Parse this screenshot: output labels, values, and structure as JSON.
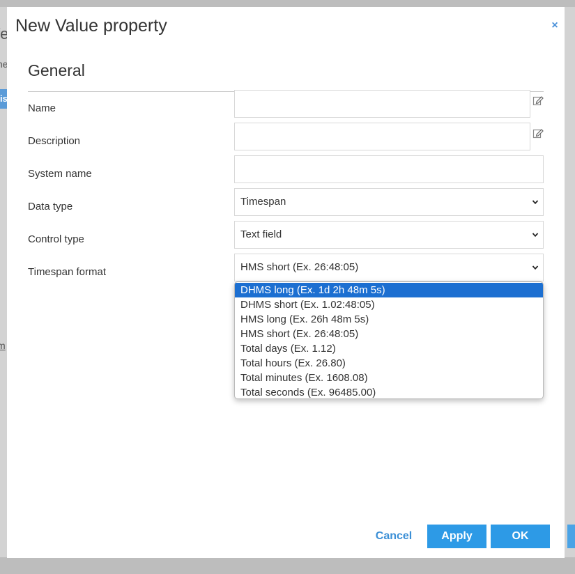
{
  "background": {
    "left_title_fragment": "fe",
    "left_text_fragment": "he",
    "left_button_fragment": "is",
    "left_link_fragment": "m"
  },
  "dialog": {
    "title": "New Value property",
    "close_glyph": "×",
    "section_title": "General"
  },
  "fields": {
    "name": {
      "label": "Name",
      "value": ""
    },
    "description": {
      "label": "Description",
      "value": ""
    },
    "system_name": {
      "label": "System name",
      "value": ""
    },
    "data_type": {
      "label": "Data type",
      "value": "Timespan"
    },
    "control_type": {
      "label": "Control type",
      "value": "Text field"
    },
    "timespan_format": {
      "label": "Timespan format",
      "value": "HMS short (Ex. 26:48:05)"
    }
  },
  "dropdown": {
    "highlighted_index": 0,
    "options": [
      "DHMS long (Ex. 1d 2h 48m 5s)",
      "DHMS short (Ex. 1.02:48:05)",
      "HMS long (Ex. 26h 48m 5s)",
      "HMS short (Ex. 26:48:05)",
      "Total days (Ex. 1.12)",
      "Total hours (Ex. 26.80)",
      "Total minutes (Ex. 1608.08)",
      "Total seconds (Ex. 96485.00)"
    ]
  },
  "footer": {
    "cancel_label": "Cancel",
    "apply_label": "Apply",
    "ok_label": "OK"
  },
  "colors": {
    "accent": "#2d9ae6",
    "link": "#3b8fd6",
    "highlight": "#1c6fd1",
    "overlay": "#bdbdbd"
  },
  "icons": {
    "close": "close-icon",
    "edit": "edit-icon",
    "chevron": "chevron-down-icon"
  }
}
